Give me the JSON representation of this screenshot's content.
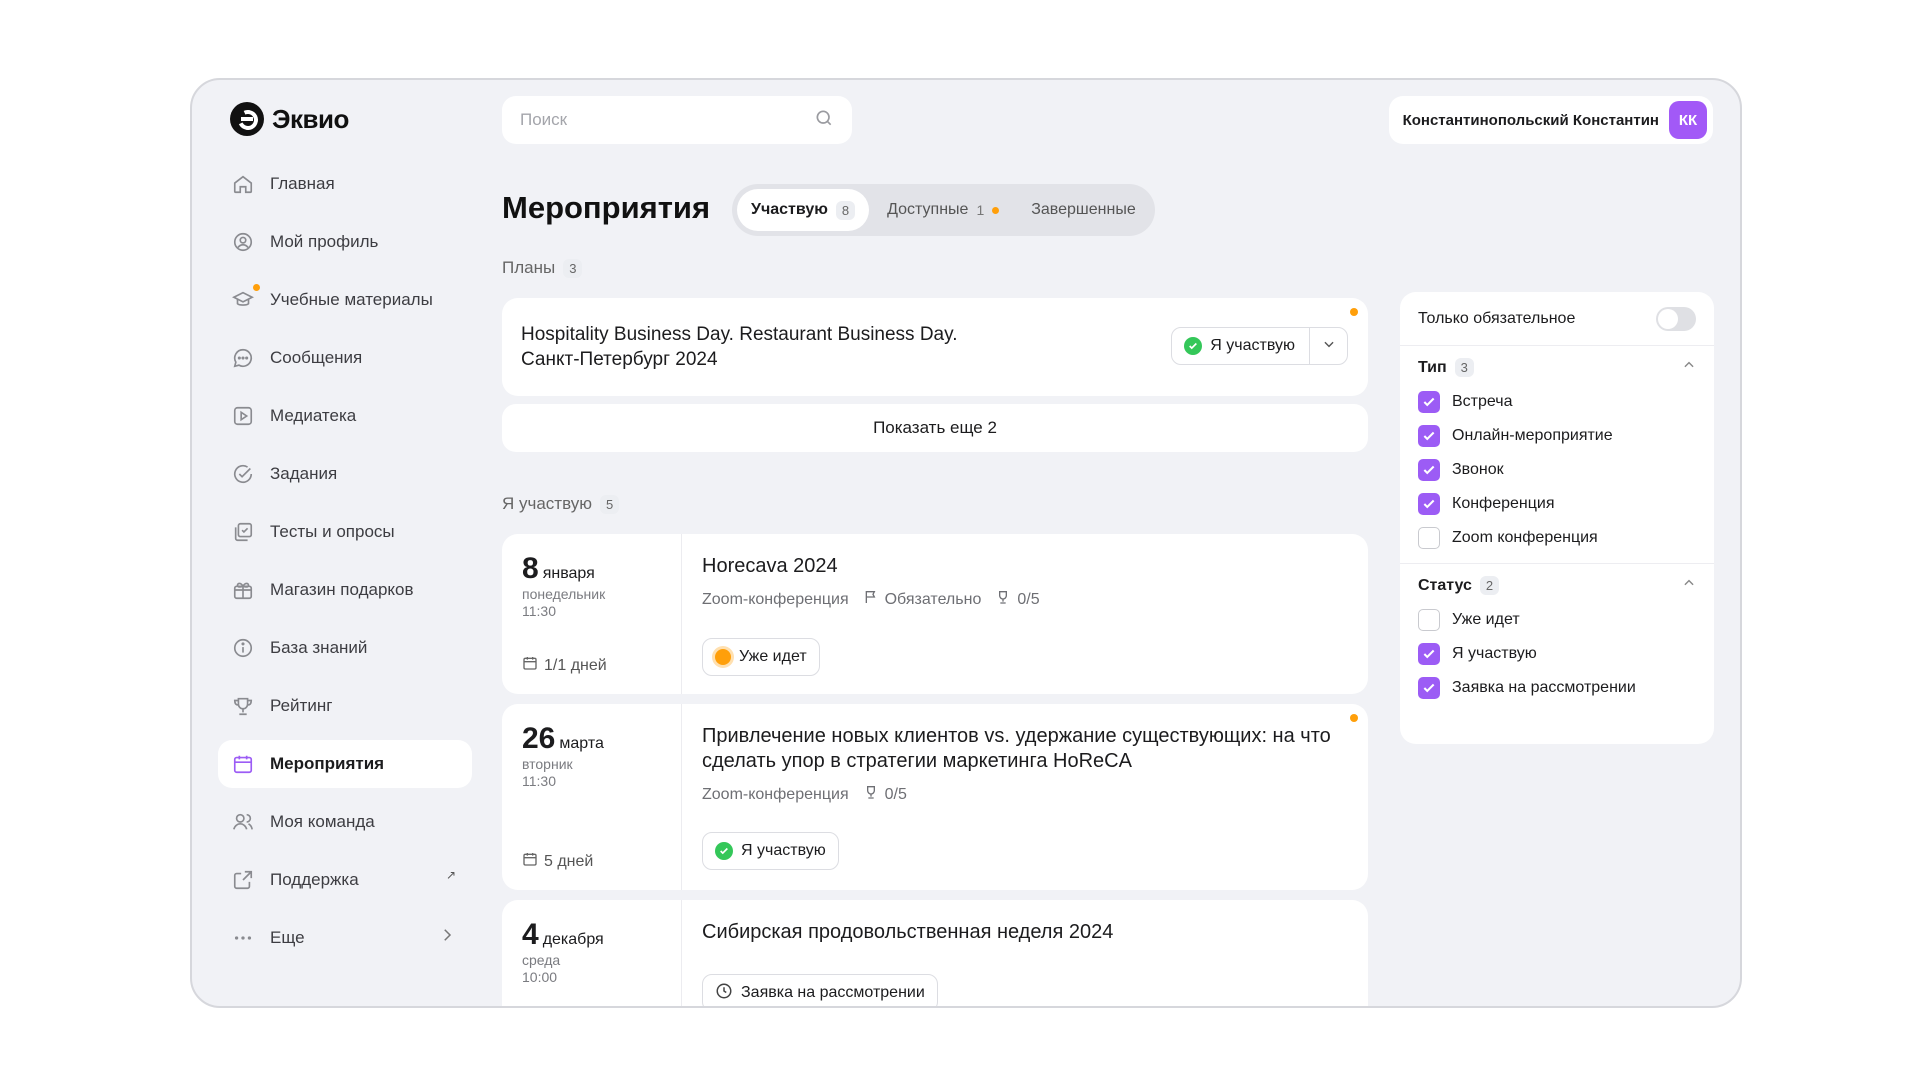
{
  "app": {
    "name": "Эквио"
  },
  "nav": [
    {
      "label": "Главная",
      "icon": "home-icon"
    },
    {
      "label": "Мой профиль",
      "icon": "profile-icon"
    },
    {
      "label": "Учебные материалы",
      "icon": "graduation-cap-icon"
    },
    {
      "label": "Сообщения",
      "icon": "message-icon"
    },
    {
      "label": "Медиатека",
      "icon": "media-icon"
    },
    {
      "label": "Задания",
      "icon": "task-check-icon"
    },
    {
      "label": "Тесты и опросы",
      "icon": "tests-icon"
    },
    {
      "label": "Магазин подарков",
      "icon": "gift-icon"
    },
    {
      "label": "База знаний",
      "icon": "info-icon"
    },
    {
      "label": "Рейтинг",
      "icon": "trophy-icon"
    },
    {
      "label": "Мероприятия",
      "icon": "calendar-icon"
    },
    {
      "label": "Моя команда",
      "icon": "team-icon"
    },
    {
      "label": "Поддержка",
      "icon": "external-link-icon"
    },
    {
      "label": "Еще",
      "icon": "more-dots-icon"
    }
  ],
  "search": {
    "placeholder": "Поиск"
  },
  "user": {
    "name": "Константинопольский Константин",
    "initials": "КК"
  },
  "page": {
    "title": "Мероприятия"
  },
  "tabs": [
    {
      "label": "Участвую",
      "count": "8"
    },
    {
      "label": "Доступные",
      "count": "1"
    },
    {
      "label": "Завершенные"
    }
  ],
  "plans": {
    "label": "Планы",
    "count": "3",
    "card": {
      "title_line1": "Hospitality Business Day. Restaurant Business Day.",
      "title_line2": "Санкт-Петербург 2024",
      "status": "Я участвую"
    },
    "show_more": "Показать еще 2"
  },
  "participating": {
    "label": "Я участвую",
    "count": "5",
    "events": [
      {
        "day": "8",
        "month": "января",
        "weekday": "понедельник",
        "time": "11:30",
        "duration": "1/1 дней",
        "title": "Horecava 2024",
        "type": "Zoom-конференция",
        "mandatory": "Обязательно",
        "score": "0/5",
        "status": "Уже идет"
      },
      {
        "day": "26",
        "month": "марта",
        "weekday": "вторник",
        "time": "11:30",
        "duration": "5 дней",
        "title_line1": "Привлечение новых клиентов vs. удержание существующих: на что",
        "title_line2": "сделать упор в стратегии маркетинга HoReCA",
        "type": "Zoom-конференция",
        "score": "0/5",
        "status": "Я участвую"
      },
      {
        "day": "4",
        "month": "декабря",
        "weekday": "среда",
        "time": "10:00",
        "title": "Сибирская продовольственная неделя 2024",
        "status": "Заявка на рассмотрении"
      }
    ]
  },
  "filters": {
    "mandatory_only": "Только обязательное",
    "type": {
      "label": "Тип",
      "count": "3",
      "options": [
        {
          "label": "Встреча",
          "checked": true
        },
        {
          "label": "Онлайн-мероприятие",
          "checked": true
        },
        {
          "label": "Звонок",
          "checked": true
        },
        {
          "label": "Конференция",
          "checked": true
        },
        {
          "label": "Zoom конференция",
          "checked": false
        }
      ]
    },
    "status": {
      "label": "Статус",
      "count": "2",
      "options": [
        {
          "label": "Уже идет",
          "checked": false
        },
        {
          "label": "Я участвую",
          "checked": true
        },
        {
          "label": "Заявка на рассмотрении",
          "checked": true
        }
      ]
    }
  },
  "colors": {
    "accent": "#9c5cf5",
    "success": "#34c759",
    "warning": "#ff9f0a",
    "avatar": "#a259f7"
  }
}
